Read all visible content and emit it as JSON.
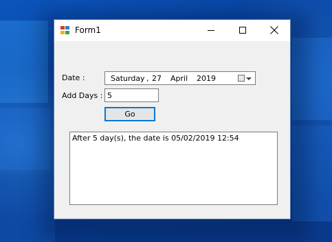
{
  "window": {
    "title": "Form1"
  },
  "form": {
    "date_label": "Date :",
    "date_picker": {
      "weekday": "Saturday",
      "separator": ",",
      "day": "27",
      "month": "April",
      "year": "2019"
    },
    "add_days_label": "Add Days :",
    "add_days_value": "5",
    "go_label": "Go",
    "output_text": "After 5 day(s), the date is 05/02/2019 12:54"
  },
  "colors": {
    "accent": "#0078d7",
    "form_background": "#f0f0f0",
    "desktop_blue": "#0b55bd"
  },
  "icons": [
    "app-icon",
    "minimize-icon",
    "maximize-icon",
    "close-icon",
    "calendar-icon",
    "dropdown-arrow-icon"
  ]
}
